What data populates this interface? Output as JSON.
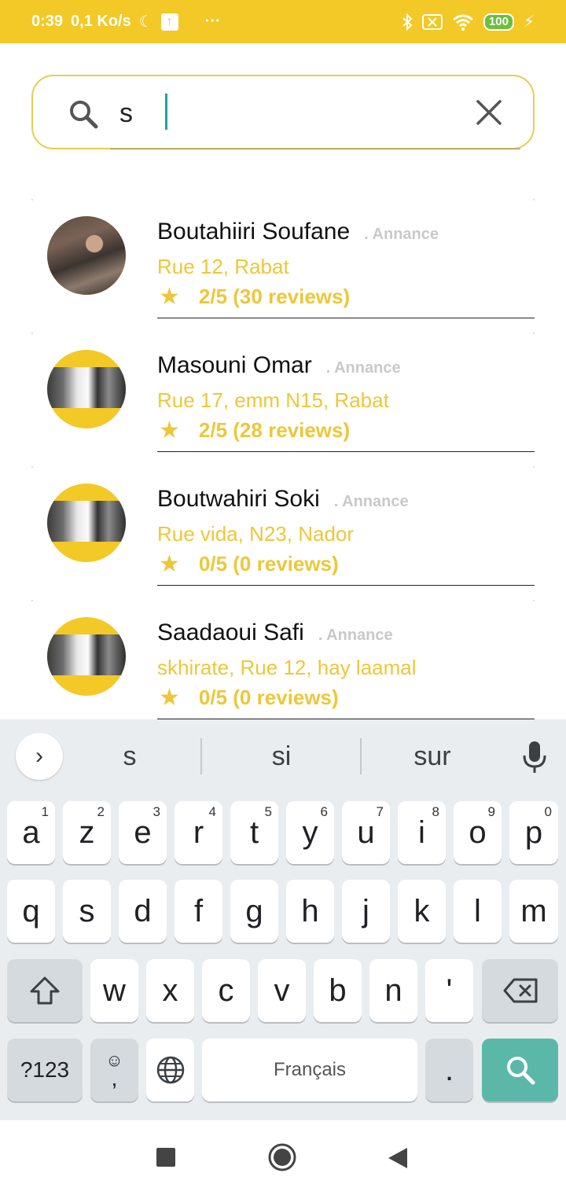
{
  "status": {
    "time": "0:39",
    "speed": "0,1 Ko/s",
    "battery": "100",
    "dots": "···"
  },
  "search": {
    "value": "s"
  },
  "results": [
    {
      "name": "Boutahiiri Soufane",
      "tag": ". Annance",
      "address": "Rue 12, Rabat",
      "rating": "2/5 (30 reviews)"
    },
    {
      "name": "Masouni Omar",
      "tag": ". Annance",
      "address": "Rue 17, emm N15, Rabat",
      "rating": "2/5 (28 reviews)"
    },
    {
      "name": "Boutwahiri Soki",
      "tag": ". Annance",
      "address": "Rue vida, N23, Nador",
      "rating": "0/5 (0 reviews)"
    },
    {
      "name": "Saadaoui Safi",
      "tag": ". Annance",
      "address": "skhirate, Rue 12, hay laamal",
      "rating": "0/5 (0 reviews)"
    }
  ],
  "keyboard": {
    "suggestions": [
      "s",
      "si",
      "sur"
    ],
    "row1": [
      {
        "k": "a",
        "n": "1"
      },
      {
        "k": "z",
        "n": "2"
      },
      {
        "k": "e",
        "n": "3"
      },
      {
        "k": "r",
        "n": "4"
      },
      {
        "k": "t",
        "n": "5"
      },
      {
        "k": "y",
        "n": "6"
      },
      {
        "k": "u",
        "n": "7"
      },
      {
        "k": "i",
        "n": "8"
      },
      {
        "k": "o",
        "n": "9"
      },
      {
        "k": "p",
        "n": "0"
      }
    ],
    "row2": [
      "q",
      "s",
      "d",
      "f",
      "g",
      "h",
      "j",
      "k",
      "l",
      "m"
    ],
    "row3": [
      "w",
      "x",
      "c",
      "v",
      "b",
      "n",
      "'"
    ],
    "symbols": "?123",
    "comma": ",",
    "space": "Français",
    "period": "."
  },
  "colors": {
    "brand": "#F2C927",
    "accent_text": "#EDC73A",
    "search_action": "#5BB8A9"
  }
}
